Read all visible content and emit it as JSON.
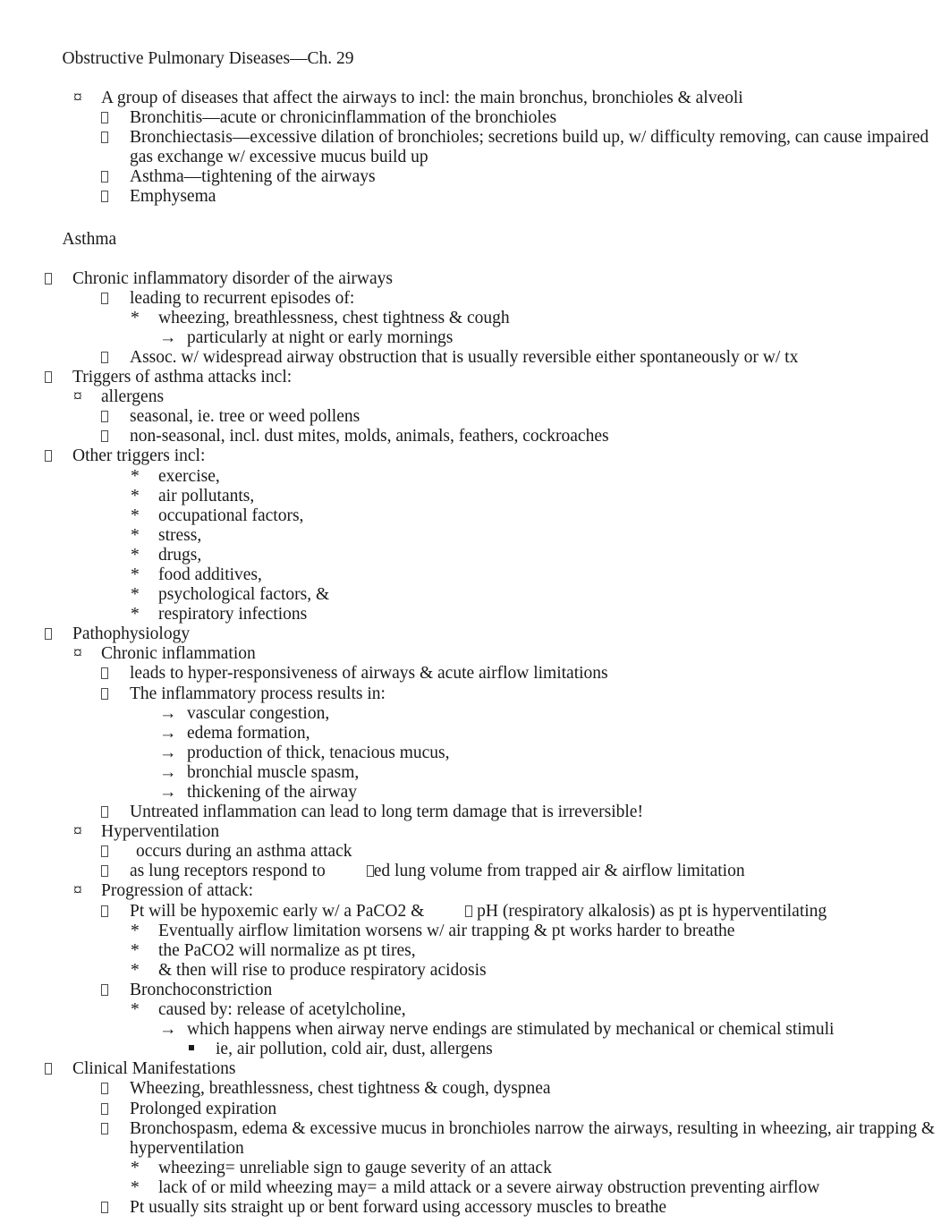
{
  "document": {
    "title": "Obstructive Pulmonary Diseases—Ch. 29",
    "section_heading": "Asthma",
    "bullet_glyphs": {
      "level1": "",
      "level2": "¤",
      "level3": "",
      "level4": "*",
      "level5": "→",
      "level6": "▪"
    },
    "colors": {
      "text": "#1a1a1a",
      "page_background": "#ffffff",
      "highlight_shade": "#ececec"
    },
    "outline": [
      {
        "id": "l1",
        "level": 2,
        "bullet": "¤",
        "text": "A group of diseases that affect the airways to incl: the main bronchus, bronchioles & alveoli"
      },
      {
        "id": "l2",
        "level": 3,
        "bullet": "",
        "text": "Bronchitis—acute or chronicinflammation of the bronchioles"
      },
      {
        "id": "l3",
        "level": 3,
        "bullet": "",
        "text": "Bronchiectasis—excessive dilation of bronchioles; secretions build up, w/ difficulty removing, can cause impaired gas exchange w/ excessive mucus build up"
      },
      {
        "id": "l4",
        "level": 3,
        "bullet": "",
        "text": "Asthma—tightening of the airways"
      },
      {
        "id": "l5",
        "level": 3,
        "bullet": "",
        "text": "Emphysema"
      },
      {
        "id": "l6",
        "level": 1,
        "bullet": "",
        "text": "Chronic inflammatory disorder of the airways"
      },
      {
        "id": "l7",
        "level": 3,
        "bullet": "",
        "text": "leading to recurrent episodes of:"
      },
      {
        "id": "l8",
        "level": 4,
        "bullet": "*",
        "text": "wheezing, breathlessness, chest tightness & cough"
      },
      {
        "id": "l9",
        "level": 5,
        "bullet": "→",
        "text": "particularly at night or early mornings"
      },
      {
        "id": "l10",
        "level": 3,
        "bullet": "",
        "text": "Assoc. w/ widespread airway obstruction that is usually reversible either spontaneously or w/ tx"
      },
      {
        "id": "l11",
        "level": 1,
        "bullet": "",
        "text": "Triggers of asthma attacks incl:"
      },
      {
        "id": "l12",
        "level": 2,
        "bullet": "¤",
        "text": "allergens"
      },
      {
        "id": "l13",
        "level": 3,
        "bullet": "",
        "text": "seasonal, ie. tree or weed pollens"
      },
      {
        "id": "l14",
        "level": 3,
        "bullet": "",
        "text": "non-seasonal, incl. dust mites, molds, animals, feathers, cockroaches"
      },
      {
        "id": "l15",
        "level": 1,
        "bullet": "",
        "text": "Other triggers incl:"
      },
      {
        "id": "l16",
        "level": 4,
        "bullet": "*",
        "text": "exercise,"
      },
      {
        "id": "l17",
        "level": 4,
        "bullet": "*",
        "text": "air pollutants,"
      },
      {
        "id": "l18",
        "level": 4,
        "bullet": "*",
        "text": "occupational factors,"
      },
      {
        "id": "l19",
        "level": 4,
        "bullet": "*",
        "text": "stress,"
      },
      {
        "id": "l20",
        "level": 4,
        "bullet": "*",
        "text": "drugs,"
      },
      {
        "id": "l21",
        "level": 4,
        "bullet": "*",
        "text": "food additives,"
      },
      {
        "id": "l22",
        "level": 4,
        "bullet": "*",
        "text": "psychological factors, &"
      },
      {
        "id": "l23",
        "level": 4,
        "bullet": "*",
        "text": "respiratory infections"
      },
      {
        "id": "l24",
        "level": 1,
        "bullet": "",
        "text": "Pathophysiology"
      },
      {
        "id": "l25",
        "level": 2,
        "bullet": "¤",
        "text": "Chronic inflammation"
      },
      {
        "id": "l26",
        "level": 3,
        "bullet": "",
        "text": "leads to hyper-responsiveness of airways & acute airflow limitations"
      },
      {
        "id": "l27",
        "level": 3,
        "bullet": "",
        "text": "The inflammatory process results in:"
      },
      {
        "id": "l28",
        "level": 5,
        "bullet": "→",
        "text": "vascular congestion,"
      },
      {
        "id": "l29",
        "level": 5,
        "bullet": "→",
        "text": "edema formation,"
      },
      {
        "id": "l30",
        "level": 5,
        "bullet": "→",
        "text": "production of thick, tenacious mucus,"
      },
      {
        "id": "l31",
        "level": 5,
        "bullet": "→",
        "text": "bronchial muscle spasm,"
      },
      {
        "id": "l32",
        "level": 5,
        "bullet": "→",
        "text": "thickening of the airway"
      },
      {
        "id": "l33",
        "level": 3,
        "bullet": "",
        "text": "Untreated inflammation can lead to long term damage that is irreversible!"
      },
      {
        "id": "l34",
        "level": 2,
        "bullet": "¤",
        "text": "Hyperventilation"
      },
      {
        "id": "l35",
        "level": 3,
        "bullet": "",
        "text": " occurs during an asthma attack"
      },
      {
        "id": "l36",
        "level": 3,
        "bullet": "",
        "text_before": "as lung receptors respond to",
        "text_after": "ed lung volume from trapped air & airflow limitation"
      },
      {
        "id": "l37",
        "level": 2,
        "bullet": "¤",
        "text": "Progression of attack:"
      },
      {
        "id": "l38",
        "level": 3,
        "bullet": "",
        "text_before": "Pt will be hypoxemic early w/ a PaCO2 &",
        "text_after": " pH (respiratory alkalosis) as pt is hyperventilating"
      },
      {
        "id": "l39",
        "level": 4,
        "bullet": "*",
        "text": "Eventually airflow limitation worsens w/ air trapping & pt works harder to breathe"
      },
      {
        "id": "l40",
        "level": 4,
        "bullet": "*",
        "text": "the PaCO2 will normalize as pt tires,"
      },
      {
        "id": "l41",
        "level": 4,
        "bullet": "*",
        "text": "& then will rise to produce respiratory acidosis"
      },
      {
        "id": "l42",
        "level": 3,
        "bullet": "",
        "text": "Bronchoconstriction"
      },
      {
        "id": "l43",
        "level": 4,
        "bullet": "*",
        "text": "caused by: release of acetylcholine,"
      },
      {
        "id": "l44",
        "level": 5,
        "bullet": "→",
        "text": "which happens when airway nerve endings are stimulated by mechanical or chemical stimuli"
      },
      {
        "id": "l45",
        "level": 6,
        "bullet": "▪",
        "text": "ie, air pollution, cold air, dust, allergens"
      },
      {
        "id": "l46",
        "level": 1,
        "bullet": "",
        "text": "Clinical Manifestations"
      },
      {
        "id": "l47",
        "level": 3,
        "bullet": "",
        "text": "Wheezing, breathlessness, chest tightness & cough, dyspnea"
      },
      {
        "id": "l48",
        "level": 3,
        "bullet": "",
        "text": "Prolonged expiration"
      },
      {
        "id": "l49",
        "level": 3,
        "bullet": "",
        "text": "Bronchospasm, edema & excessive mucus in bronchioles narrow the airways, resulting in wheezing, air trapping & hyperventilation"
      },
      {
        "id": "l50",
        "level": 4,
        "bullet": "*",
        "text": "wheezing= unreliable sign to gauge severity of an attack"
      },
      {
        "id": "l51",
        "level": 4,
        "bullet": "*",
        "text": "lack of or mild wheezing may= a mild attack or a severe airway obstruction preventing airflow"
      },
      {
        "id": "l52",
        "level": 3,
        "bullet": "",
        "text": "Pt usually sits straight up or bent forward using accessory muscles to breathe"
      }
    ]
  }
}
